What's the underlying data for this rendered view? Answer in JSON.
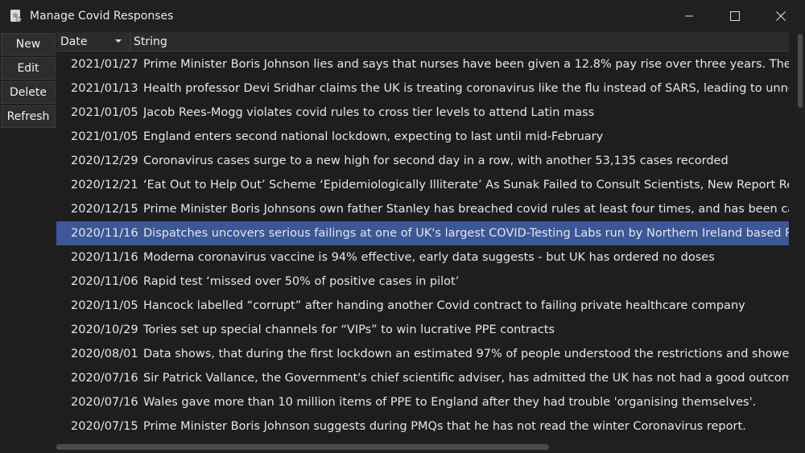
{
  "window": {
    "title": "Manage Covid Responses",
    "icon": "app-icon"
  },
  "sidebar": {
    "buttons": [
      {
        "label": "New"
      },
      {
        "label": "Edit"
      },
      {
        "label": "Delete"
      },
      {
        "label": "Refresh"
      }
    ]
  },
  "table": {
    "columns": {
      "date": "Date",
      "string": "String"
    },
    "sort": {
      "column": "Date",
      "direction": "descending"
    },
    "selected_index": 7,
    "selection_color": "#3c5696",
    "rows": [
      {
        "date": "2021/01/27",
        "text": "Prime Minister Boris Johnson lies and says that nurses have been given a 12.8% pay rise over three years. The Royal College"
      },
      {
        "date": "2021/01/13",
        "text": "Health professor Devi Sridhar claims the UK is treating coronavirus like the flu instead of SARS, leading to unnecessary deaths"
      },
      {
        "date": "2021/01/05",
        "text": "Jacob Rees-Mogg violates covid rules to cross tier levels to attend Latin mass"
      },
      {
        "date": "2021/01/05",
        "text": "England enters second national lockdown, expecting to last until mid-February"
      },
      {
        "date": "2020/12/29",
        "text": "Coronavirus cases surge to a new high for second day in a row, with another 53,135 cases recorded"
      },
      {
        "date": "2020/12/21",
        "text": "‘Eat Out to Help Out’ Scheme ‘Epidemiologically Illiterate’ As Sunak Failed to Consult Scientists, New Report Reveals"
      },
      {
        "date": "2020/12/15",
        "text": "Prime Minister Boris Johnsons own father Stanley has breached covid rules at least four times, and has been caught trying"
      },
      {
        "date": "2020/11/16",
        "text": "Dispatches uncovers serious failings at one of UK's largest COVID-Testing Labs run by Northern Ireland based Randox"
      },
      {
        "date": "2020/11/16",
        "text": "Moderna coronavirus vaccine is 94% effective, early data suggests - but UK has ordered no doses"
      },
      {
        "date": "2020/11/06",
        "text": "Rapid test ‘missed over 50% of positive cases in pilot’"
      },
      {
        "date": "2020/11/05",
        "text": "Hancock labelled “corrupt” after handing another Covid contract to failing private healthcare company"
      },
      {
        "date": "2020/10/29",
        "text": "Tories set up special channels for “VIPs” to win lucrative PPE contracts"
      },
      {
        "date": "2020/08/01",
        "text": "Data shows, that during the first lockdown an estimated 97% of people understood the restrictions and showed compliance"
      },
      {
        "date": "2020/07/16",
        "text": "Sir Patrick Vallance, the Government's chief scientific adviser, has admitted the UK has not had a good outcome from the C"
      },
      {
        "date": "2020/07/16",
        "text": "Wales gave more than 10 million items of PPE to England after they had trouble 'organising themselves'."
      },
      {
        "date": "2020/07/15",
        "text": "Prime Minister Boris Johnson suggests during PMQs that he has not read the winter Coronavirus report."
      }
    ]
  }
}
